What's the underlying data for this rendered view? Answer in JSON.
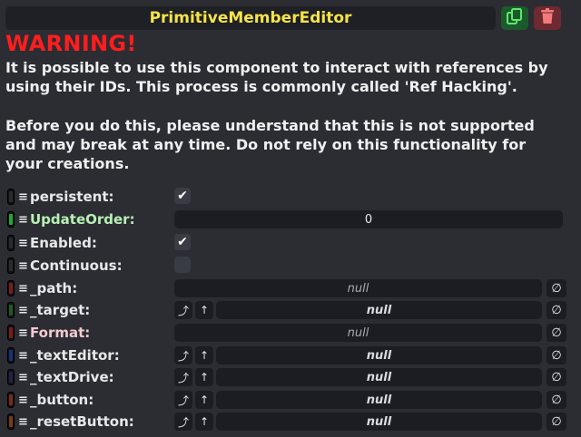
{
  "header": {
    "title": "PrimitiveMemberEditor",
    "duplicate_icon": "duplicate-icon",
    "delete_icon": "trash-icon",
    "title_color": "#f5e34a"
  },
  "warning": {
    "title": "WARNING!",
    "para1": "It is possible to use this component to interact with references by using their IDs. This process is commonly called 'Ref Hacking'.",
    "para2_before": "Before",
    "para2_mid": " you do this, please understand that this is ",
    "para2_not": "not",
    "para2_after": " supported and may break at any time. Do not rely on this functionality for your creations."
  },
  "members": [
    {
      "label": "persistent:",
      "kind": "checkbox",
      "checked": true,
      "tag_color": "#2a2c30"
    },
    {
      "label": "UpdateOrder:",
      "kind": "number",
      "value": "0",
      "tag_color": "#1faa2b"
    },
    {
      "label": "Enabled:",
      "kind": "checkbox",
      "checked": true,
      "tag_color": "#2a2c30"
    },
    {
      "label": "Continuous:",
      "kind": "checkbox",
      "checked": false,
      "tag_color": "#2a2c30"
    },
    {
      "label": "_path:",
      "kind": "ref",
      "value": "null",
      "tag_color": "#7a1d1d"
    },
    {
      "label": "_target:",
      "kind": "slotref",
      "value": "null",
      "tag_color": "#1f5a22"
    },
    {
      "label": "Format:",
      "kind": "ref",
      "value": "null",
      "tag_color": "#7a1d1d"
    },
    {
      "label": "_textEditor:",
      "kind": "slotref",
      "value": "null",
      "tag_color": "#1c2f7a"
    },
    {
      "label": "_textDrive:",
      "kind": "slotref",
      "value": "null",
      "tag_color": "#222244"
    },
    {
      "label": "_button:",
      "kind": "slotref",
      "value": "null",
      "tag_color": "#7a2a1a"
    },
    {
      "label": "_resetButton:",
      "kind": "slotref",
      "value": "null",
      "tag_color": "#7a3a1a"
    }
  ],
  "buttons": {
    "grip": "≡",
    "check": "✔",
    "jump": "⤴",
    "up": "↑",
    "null_btn": "∅"
  }
}
